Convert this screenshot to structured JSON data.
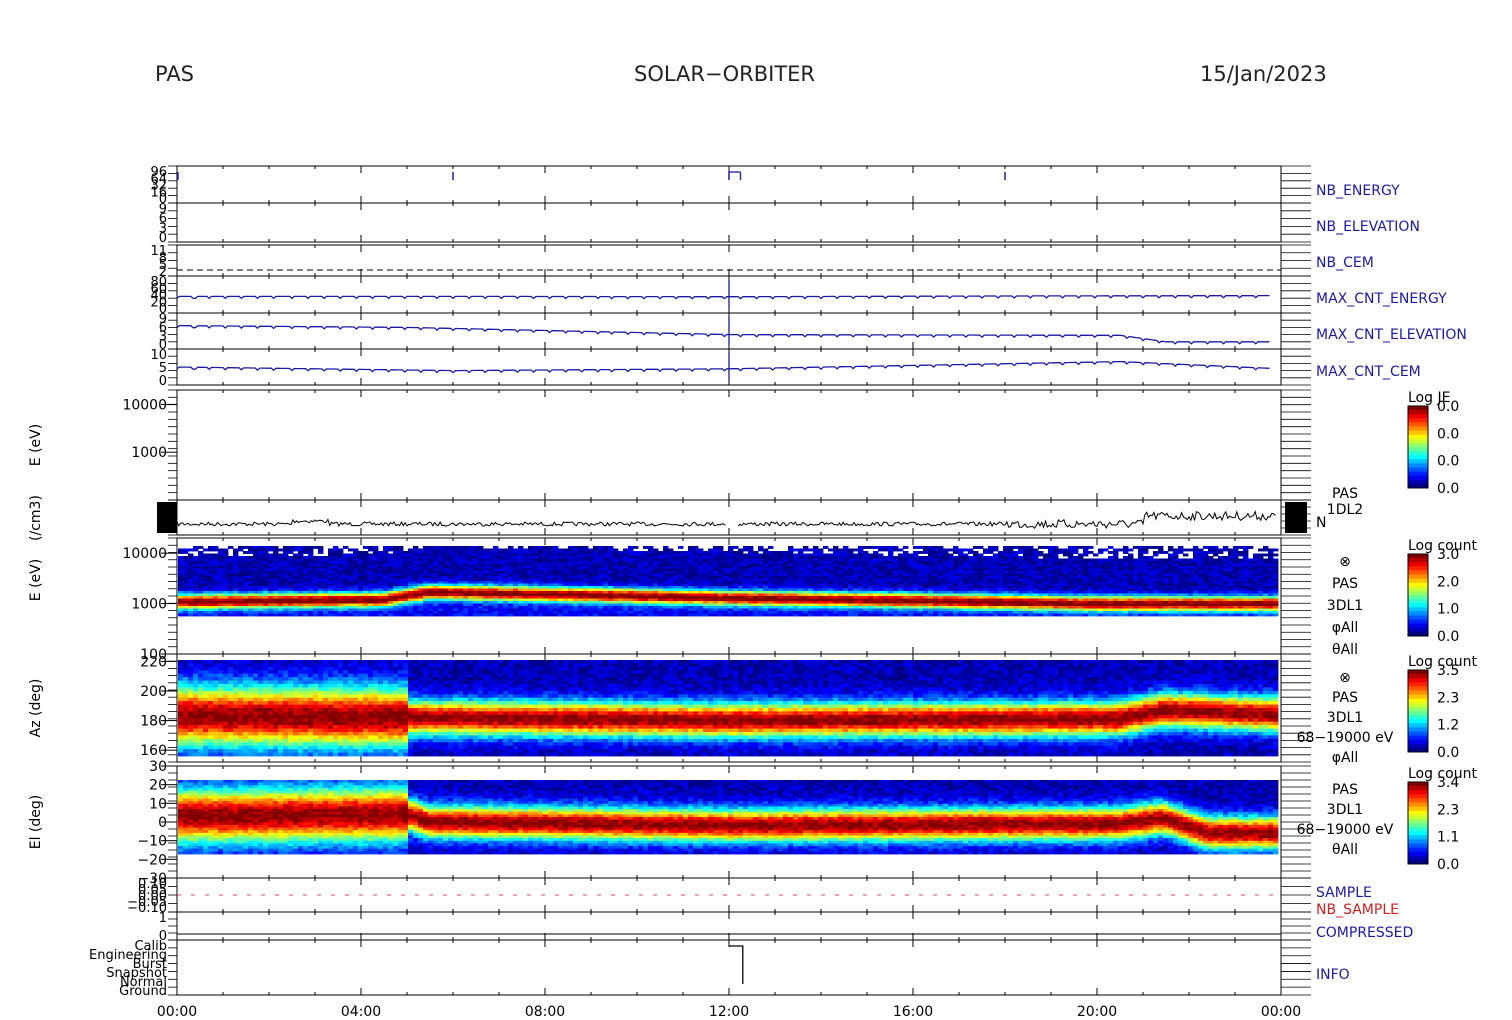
{
  "header": {
    "left": "PAS",
    "center": "SOLAR−ORBITER",
    "right": "15/Jan/2023"
  },
  "chart_data": {
    "type": "heatmap",
    "time_axis": {
      "ticks": [
        "00:00",
        "04:00",
        "08:00",
        "12:00",
        "16:00",
        "20:00",
        "00:00"
      ],
      "range_hours": [
        0,
        24
      ]
    },
    "panels": [
      {
        "label": "NB_ENERGY",
        "label_color": "#1a1aa6",
        "type": "line",
        "tick_labels": [
          "96",
          "64",
          "32",
          "16",
          "0"
        ],
        "events": [
          {
            "t": 0.02
          },
          {
            "t": 6.0
          },
          {
            "t": 12.0
          },
          {
            "t": 18.0
          }
        ]
      },
      {
        "label": "NB_ELEVATION",
        "label_color": "#1a1aa6",
        "type": "line",
        "tick_labels": [
          "9",
          "6",
          "3",
          "0"
        ]
      },
      {
        "label": "NB_CEM",
        "label_color": "#1a1aa6",
        "type": "line",
        "tick_labels": [
          "11",
          "8",
          "5",
          "2"
        ],
        "dashed_level": true
      },
      {
        "label": "MAX_CNT_ENERGY",
        "label_color": "#1a1aa6",
        "type": "line",
        "tick_labels": [
          "80",
          "60",
          "40",
          "20",
          "0"
        ],
        "series": [
          {
            "t": 0,
            "v": 0.55
          },
          {
            "t": 6,
            "v": 0.55
          },
          {
            "t": 12,
            "v": 0.56
          },
          {
            "t": 18,
            "v": 0.54
          },
          {
            "t": 24,
            "v": 0.53
          }
        ]
      },
      {
        "label": "MAX_CNT_ELEVATION",
        "label_color": "#1a1aa6",
        "type": "line",
        "tick_labels": [
          "9",
          "6",
          "3",
          "0"
        ],
        "series": [
          {
            "t": 0,
            "v": 0.35
          },
          {
            "t": 5,
            "v": 0.4
          },
          {
            "t": 12,
            "v": 0.6
          },
          {
            "t": 20.5,
            "v": 0.62
          },
          {
            "t": 21.5,
            "v": 0.8
          },
          {
            "t": 23.3,
            "v": 0.8
          }
        ]
      },
      {
        "label": "MAX_CNT_CEM",
        "label_color": "#1a1aa6",
        "type": "line",
        "tick_labels": [
          "10",
          "5",
          "0"
        ],
        "series": [
          {
            "t": 0,
            "v": 0.5
          },
          {
            "t": 6,
            "v": 0.6
          },
          {
            "t": 12,
            "v": 0.55
          },
          {
            "t": 20.5,
            "v": 0.35
          },
          {
            "t": 24,
            "v": 0.55
          }
        ]
      },
      {
        "label": "",
        "type": "spectrogram_empty",
        "ylabel": "E (eV)",
        "ylim": [
          100,
          20000
        ],
        "scale": "log",
        "yticks": [
          "10000",
          "1000"
        ],
        "colorbar": {
          "title": "Log JE",
          "ticks": [
            "0.0",
            "0.0",
            "0.0",
            "0.0"
          ]
        }
      },
      {
        "label": "N",
        "type": "line",
        "ylabel": "(/cm3)",
        "side_text": [
          "PAS",
          "1DL2"
        ]
      },
      {
        "label": "",
        "type": "spectrogram",
        "ylabel": "E (eV)",
        "ylim": [
          100,
          20000
        ],
        "scale": "log",
        "yticks": [
          "10000",
          "1000",
          "100"
        ],
        "side_text": [
          "⊗",
          "PAS",
          "3DL1",
          "φAll",
          "θAll"
        ],
        "colorbar": {
          "title": "Log count",
          "ticks": [
            "3.0",
            "2.0",
            "1.0",
            "0.0"
          ],
          "range": [
            0,
            3.0
          ]
        },
        "peak_energy_ev": [
          {
            "t": 0,
            "e": 1100
          },
          {
            "t": 4.5,
            "e": 1200
          },
          {
            "t": 5.5,
            "e": 1700
          },
          {
            "t": 12,
            "e": 1300
          },
          {
            "t": 16,
            "e": 1150
          },
          {
            "t": 20,
            "e": 1000
          },
          {
            "t": 24,
            "e": 1000
          }
        ]
      },
      {
        "label": "",
        "type": "spectrogram",
        "ylabel": "Az (deg)",
        "ylim": [
          152,
          225
        ],
        "yticks": [
          "220",
          "200",
          "180",
          "160"
        ],
        "side_text": [
          "⊗",
          "PAS",
          "3DL1",
          "68−19000 eV",
          "φAll"
        ],
        "colorbar": {
          "title": "Log count",
          "ticks": [
            "3.5",
            "2.3",
            "1.2",
            "0.0"
          ],
          "range": [
            0,
            3.5
          ]
        },
        "peak_az_deg": [
          {
            "t": 0,
            "a": 183
          },
          {
            "t": 5,
            "a": 182
          },
          {
            "t": 12,
            "a": 180
          },
          {
            "t": 20.5,
            "a": 181
          },
          {
            "t": 21.5,
            "a": 187
          },
          {
            "t": 24,
            "a": 184
          }
        ]
      },
      {
        "label": "",
        "type": "spectrogram",
        "ylabel": "El (deg)",
        "ylim": [
          -30,
          30
        ],
        "yticks": [
          "30",
          "20",
          "10",
          "0",
          "−10",
          "−20",
          "−30"
        ],
        "side_text": [
          "PAS",
          "3DL1",
          "68−19000 eV",
          "θAll"
        ],
        "colorbar": {
          "title": "Log count",
          "ticks": [
            "3.4",
            "2.3",
            "1.1",
            "0.0"
          ],
          "range": [
            0,
            3.4
          ]
        },
        "peak_el_deg": [
          {
            "t": 0,
            "e": 3
          },
          {
            "t": 5,
            "e": 4
          },
          {
            "t": 5.5,
            "e": 0
          },
          {
            "t": 12,
            "e": -2
          },
          {
            "t": 20.5,
            "e": -1
          },
          {
            "t": 21.5,
            "e": 2
          },
          {
            "t": 22.5,
            "e": -6
          },
          {
            "t": 24,
            "e": -6
          }
        ]
      },
      {
        "label": "SAMPLE",
        "label2": "NB_SAMPLE",
        "label_color": "#1a1aa6",
        "label2_color": "#d42020",
        "type": "line",
        "tick_labels": [
          "0.10",
          "0.05",
          "0.00",
          "−0.05",
          "−0.10"
        ]
      },
      {
        "label": "COMPRESSED",
        "label_color": "#1a1aa6",
        "type": "line",
        "tick_labels": [
          "1",
          "0"
        ]
      },
      {
        "label": "INFO",
        "label_color": "#1a1aa6",
        "type": "line",
        "tick_labels": [
          "Calib",
          "Engineering",
          "Burst",
          "Snapshot",
          "Normal",
          "Ground"
        ]
      }
    ]
  }
}
